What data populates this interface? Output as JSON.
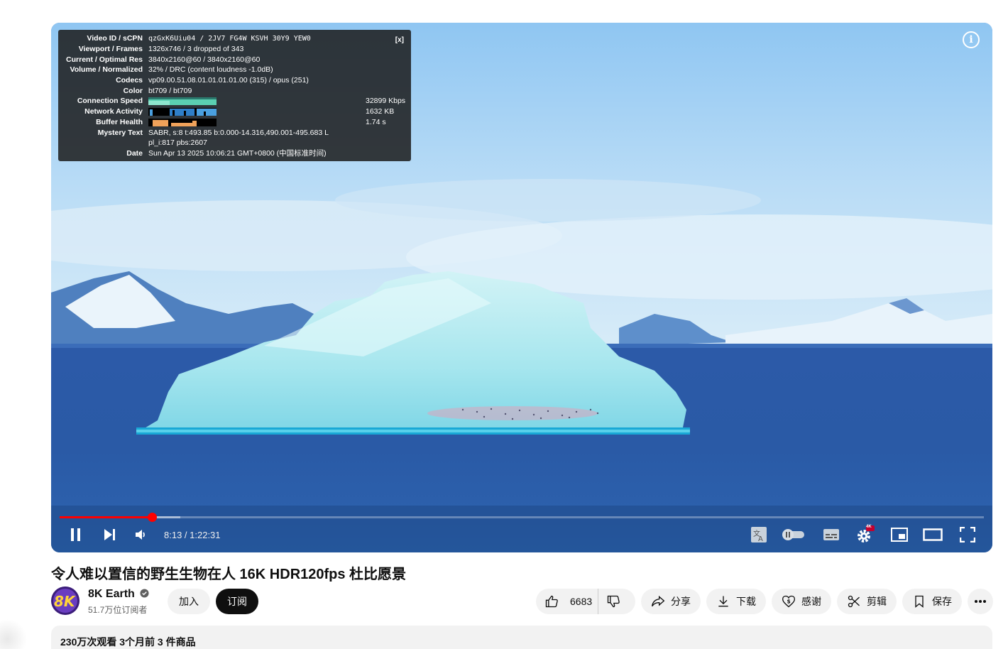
{
  "stats": {
    "close_label": "[x]",
    "rows": [
      {
        "label": "Video ID / sCPN",
        "value": "qzGxK6Uiu04 / 2JV7 FG4W KSVH 30Y9 YEW0"
      },
      {
        "label": "Viewport / Frames",
        "value": "1326x746 / 3 dropped of 343"
      },
      {
        "label": "Current / Optimal Res",
        "value": "3840x2160@60 / 3840x2160@60"
      },
      {
        "label": "Volume / Normalized",
        "value": "32% / DRC (content loudness -1.0dB)"
      },
      {
        "label": "Codecs",
        "value": "vp09.00.51.08.01.01.01.01.00 (315) / opus (251)"
      },
      {
        "label": "Color",
        "value": "bt709 / bt709"
      },
      {
        "label": "Connection Speed",
        "value": "32899 Kbps"
      },
      {
        "label": "Network Activity",
        "value": "1632 KB"
      },
      {
        "label": "Buffer Health",
        "value": "1.74 s"
      },
      {
        "label": "Mystery Text",
        "value": "SABR, s:8 t:493.85 b:0.000-14.316,490.001-495.683 L"
      },
      {
        "label": "",
        "value": "pl_i:817 pbs:2607"
      },
      {
        "label": "Date",
        "value": "Sun Apr 13 2025 10:06:21 GMT+0800 (中国标准时间)"
      }
    ]
  },
  "player": {
    "time": "8:13 / 1:22:31",
    "progress_fraction": 0.0995,
    "quality_badge": "4K",
    "info_icon": "i"
  },
  "video": {
    "title": "令人难以置信的野生生物在人 16K HDR120fps 杜比愿景",
    "channel": "8K Earth",
    "avatar_text": "8K",
    "subscribers": "51.7万位订阅者",
    "join_label": "加入",
    "subscribe_label": "订阅",
    "likes": "6683",
    "share_label": "分享",
    "download_label": "下载",
    "thanks_label": "感谢",
    "clip_label": "剪辑",
    "save_label": "保存",
    "meta": "230万次观看  3个月前  3 件商品"
  },
  "colors": {
    "accent": "#ff0000",
    "subscribe_bg": "#0f0f0f",
    "pill_bg": "#f2f2f2"
  }
}
